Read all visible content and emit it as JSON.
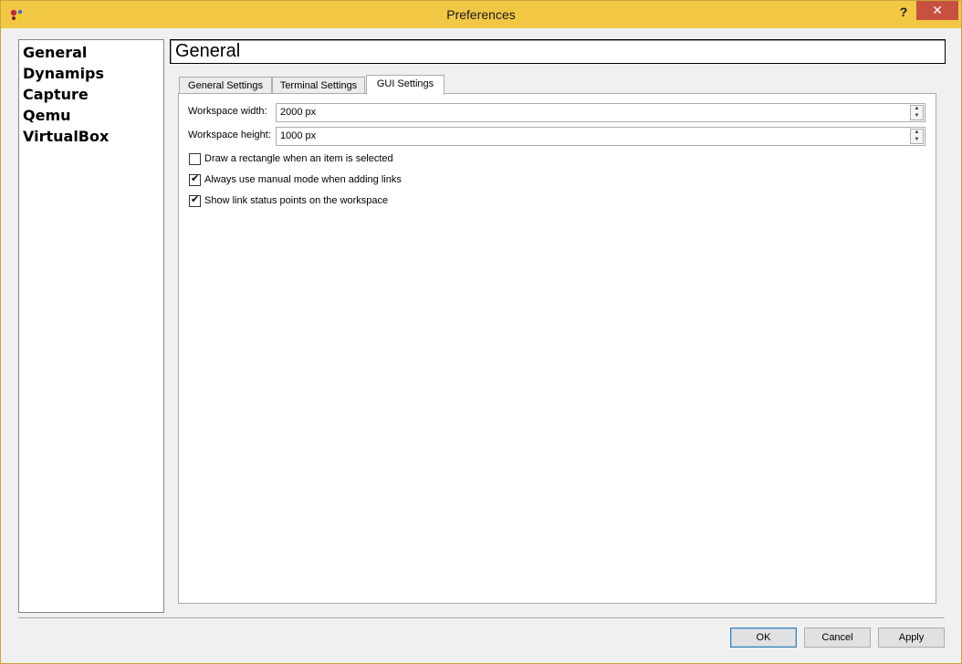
{
  "window": {
    "title": "Preferences",
    "help_label": "?",
    "close_label": "✕"
  },
  "sidebar": {
    "items": [
      {
        "label": "General"
      },
      {
        "label": "Dynamips"
      },
      {
        "label": "Capture"
      },
      {
        "label": "Qemu"
      },
      {
        "label": "VirtualBox"
      }
    ]
  },
  "page": {
    "heading": "General"
  },
  "tabs": [
    {
      "label": "General Settings"
    },
    {
      "label": "Terminal Settings"
    },
    {
      "label": "GUI Settings",
      "active": true
    }
  ],
  "gui_settings": {
    "workspace_width_label": "Workspace width:",
    "workspace_width_value": "2000 px",
    "workspace_height_label": "Workspace height:",
    "workspace_height_value": "1000 px",
    "checkboxes": [
      {
        "label": "Draw a rectangle when an item is selected",
        "checked": false
      },
      {
        "label": "Always use manual mode when adding links",
        "checked": true
      },
      {
        "label": "Show link status points on the workspace",
        "checked": true
      }
    ]
  },
  "buttons": {
    "ok": "OK",
    "cancel": "Cancel",
    "apply": "Apply"
  },
  "colors": {
    "titlebar": "#f2c744",
    "close": "#c7503f"
  }
}
